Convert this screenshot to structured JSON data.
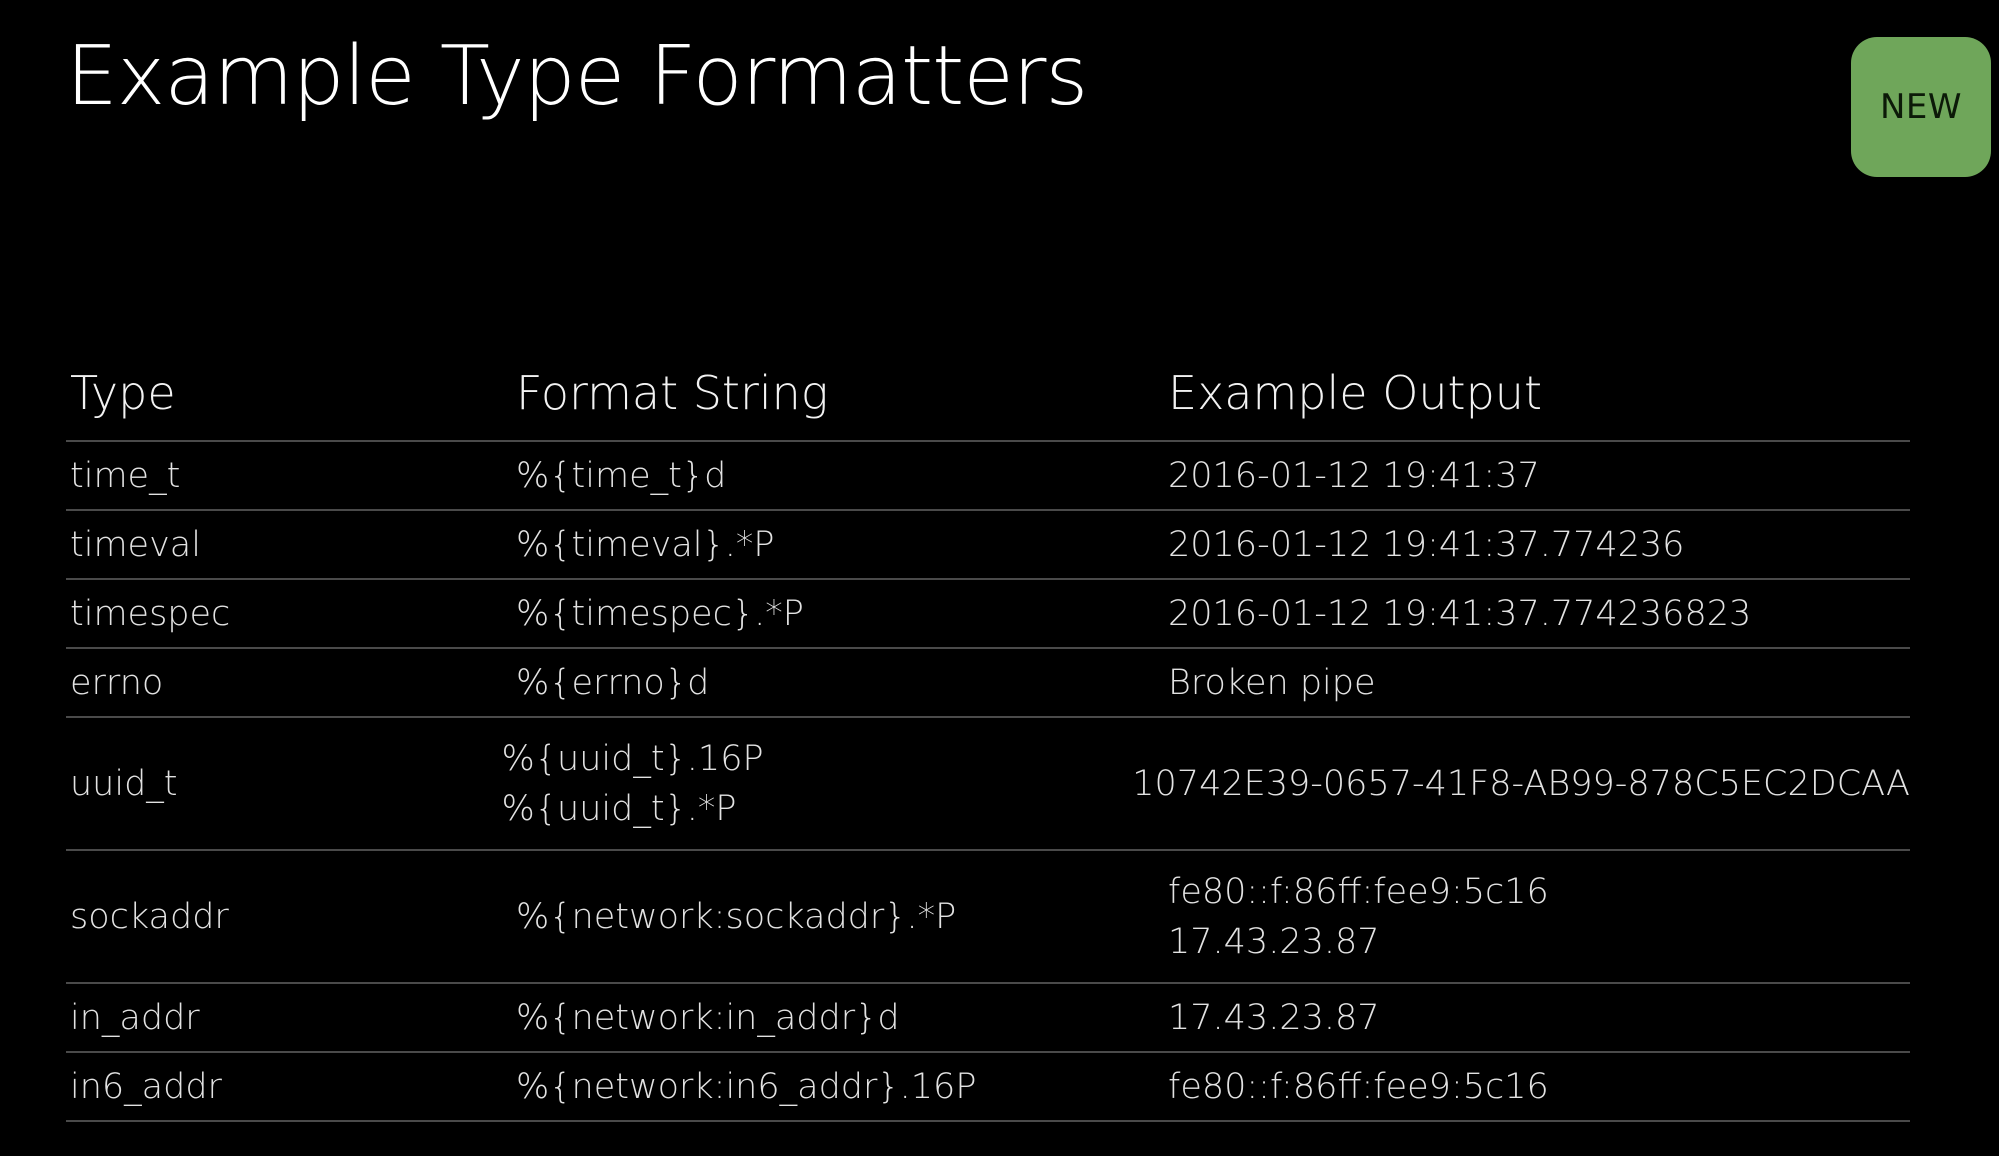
{
  "slide": {
    "title": "Example Type Formatters",
    "badge": "NEW",
    "badge_color": "#6fa65a"
  },
  "table": {
    "headers": [
      "Type",
      "Format String",
      "Example Output"
    ],
    "rows": [
      {
        "type": "time_t",
        "format": [
          "%{time_t}d"
        ],
        "output": [
          "2016-01-12 19:41:37"
        ]
      },
      {
        "type": "timeval",
        "format": [
          "%{timeval}.*P"
        ],
        "output": [
          "2016-01-12 19:41:37.774236"
        ]
      },
      {
        "type": "timespec",
        "format": [
          "%{timespec}.*P"
        ],
        "output": [
          "2016-01-12 19:41:37.774236823"
        ]
      },
      {
        "type": "errno",
        "format": [
          "%{errno}d"
        ],
        "output": [
          "Broken pipe"
        ]
      },
      {
        "type": "uuid_t",
        "format": [
          "%{uuid_t}.16P",
          "%{uuid_t}.*P"
        ],
        "output": [
          "10742E39-0657-41F8-AB99-878C5EC2DCAA"
        ]
      },
      {
        "type": "sockaddr",
        "format": [
          "%{network:sockaddr}.*P"
        ],
        "output": [
          "fe80::f:86ff:fee9:5c16",
          "17.43.23.87"
        ]
      },
      {
        "type": "in_addr",
        "format": [
          "%{network:in_addr}d"
        ],
        "output": [
          "17.43.23.87"
        ]
      },
      {
        "type": "in6_addr",
        "format": [
          "%{network:in6_addr}.16P"
        ],
        "output": [
          "fe80::f:86ff:fee9:5c16"
        ]
      }
    ]
  }
}
